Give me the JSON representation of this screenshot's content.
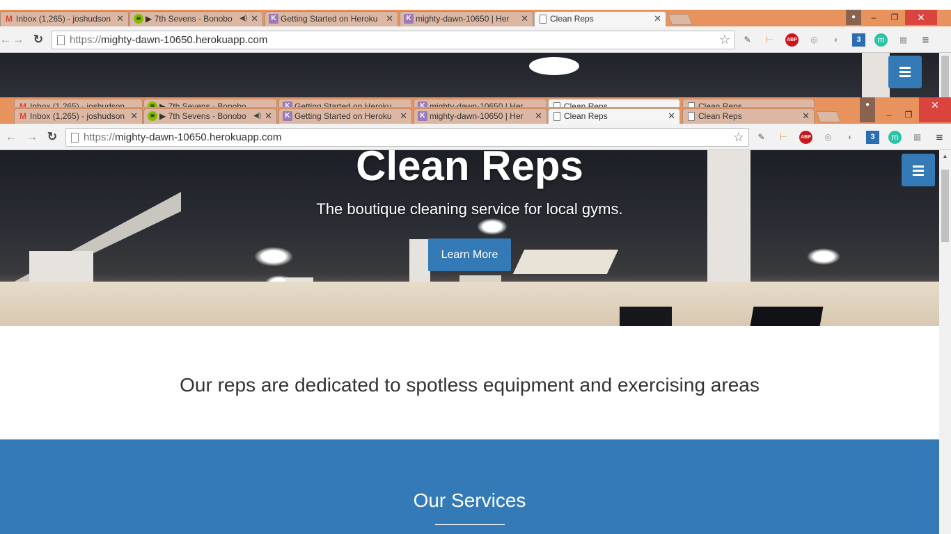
{
  "browser": {
    "tabs": [
      {
        "title": "Inbox (1,265) - joshudson",
        "icon": "gmail-icon"
      },
      {
        "title": "▶ 7th Sevens - Bonobo",
        "icon": "spotify-icon",
        "audio": "◀)"
      },
      {
        "title": "Getting Started on Heroku",
        "icon": "heroku-icon"
      },
      {
        "title": "mighty-dawn-10650 | Her",
        "icon": "heroku-icon"
      },
      {
        "title": "Clean Reps",
        "icon": "page-icon"
      },
      {
        "title": "Clean Reps",
        "icon": "page-icon"
      }
    ],
    "close_glyph": "✕",
    "url_scheme": "https://",
    "url_host": "mighty-dawn-10650.herokuapp.com",
    "extensions": [
      "eyedropper-icon",
      "ruler-icon",
      "adblock-icon",
      "swirl-icon",
      "ghost-icon",
      "css3-icon",
      "m-icon",
      "grid-icon",
      "menu-icon"
    ],
    "abp_label": "ABP",
    "css3_label": "3",
    "m_label": "m"
  },
  "site": {
    "title": "Clean Reps",
    "subtitle": "The boutique cleaning service for local gyms.",
    "cta_label": "Learn More",
    "tagline": "Our reps are dedicated to spotless equipment and exercising areas",
    "services_heading": "Our Services",
    "accent_color": "#337ab7"
  }
}
